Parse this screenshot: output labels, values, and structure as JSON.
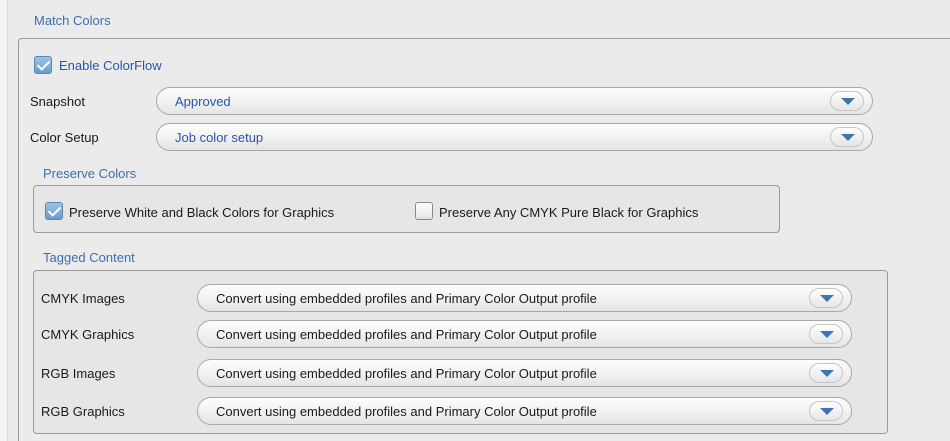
{
  "match_colors": {
    "title": "Match Colors",
    "enable_colorflow": {
      "label": "Enable ColorFlow",
      "checked": true
    },
    "snapshot": {
      "label": "Snapshot",
      "value": "Approved"
    },
    "color_setup": {
      "label": "Color Setup",
      "value": "Job color setup"
    }
  },
  "preserve_colors": {
    "title": "Preserve Colors",
    "preserve_white_black": {
      "label": "Preserve White and Black Colors for Graphics",
      "checked": true
    },
    "preserve_cmyk_black": {
      "label": "Preserve Any CMYK Pure Black for Graphics",
      "checked": false
    }
  },
  "tagged_content": {
    "title": "Tagged Content",
    "rows": [
      {
        "label": "CMYK Images",
        "value": "Convert using embedded profiles and Primary Color Output profile"
      },
      {
        "label": "CMYK Graphics",
        "value": "Convert using embedded profiles and Primary Color Output profile"
      },
      {
        "label": "RGB Images",
        "value": "Convert using embedded profiles and Primary Color Output profile"
      },
      {
        "label": "RGB Graphics",
        "value": "Convert using embedded profiles and Primary Color Output profile"
      }
    ]
  }
}
